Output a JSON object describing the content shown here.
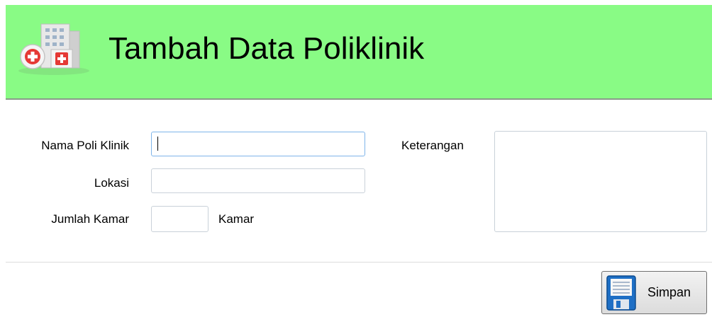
{
  "header": {
    "title": "Tambah Data Poliklinik",
    "icon": "hospital-building-icon",
    "background_color": "#89fb85"
  },
  "form": {
    "nama_poli_klinik": {
      "label": "Nama Poli Klinik",
      "value": ""
    },
    "lokasi": {
      "label": "Lokasi",
      "value": ""
    },
    "jumlah_kamar": {
      "label": "Jumlah Kamar",
      "value": "",
      "unit": "Kamar"
    },
    "keterangan": {
      "label": "Keterangan",
      "value": ""
    }
  },
  "actions": {
    "save_label": "Simpan",
    "save_icon": "floppy-disk-icon"
  }
}
